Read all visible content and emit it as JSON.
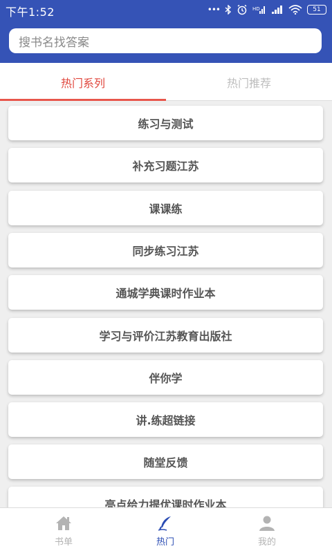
{
  "status_bar": {
    "time": "下午1:52",
    "battery": "51"
  },
  "search": {
    "placeholder": "搜书名找答案"
  },
  "tabs": [
    {
      "label": "热门系列",
      "active": true
    },
    {
      "label": "热门推荐",
      "active": false
    }
  ],
  "colors": {
    "primary": "#3553b6",
    "accent": "#e0463c",
    "nav_active": "#2a4cb3",
    "nav_inactive": "#b3b3b3"
  },
  "list": [
    "练习与测试",
    "补充习题江苏",
    "课课练",
    "同步练习江苏",
    "通城学典课时作业本",
    "学习与评价江苏教育出版社",
    "伴你学",
    "讲.练超链接",
    "随堂反馈",
    "亮点给力提优课时作业本"
  ],
  "bottom_nav": [
    {
      "label": "书单",
      "icon": "home-icon",
      "active": false
    },
    {
      "label": "热门",
      "icon": "quill-icon",
      "active": true
    },
    {
      "label": "我的",
      "icon": "person-icon",
      "active": false
    }
  ]
}
